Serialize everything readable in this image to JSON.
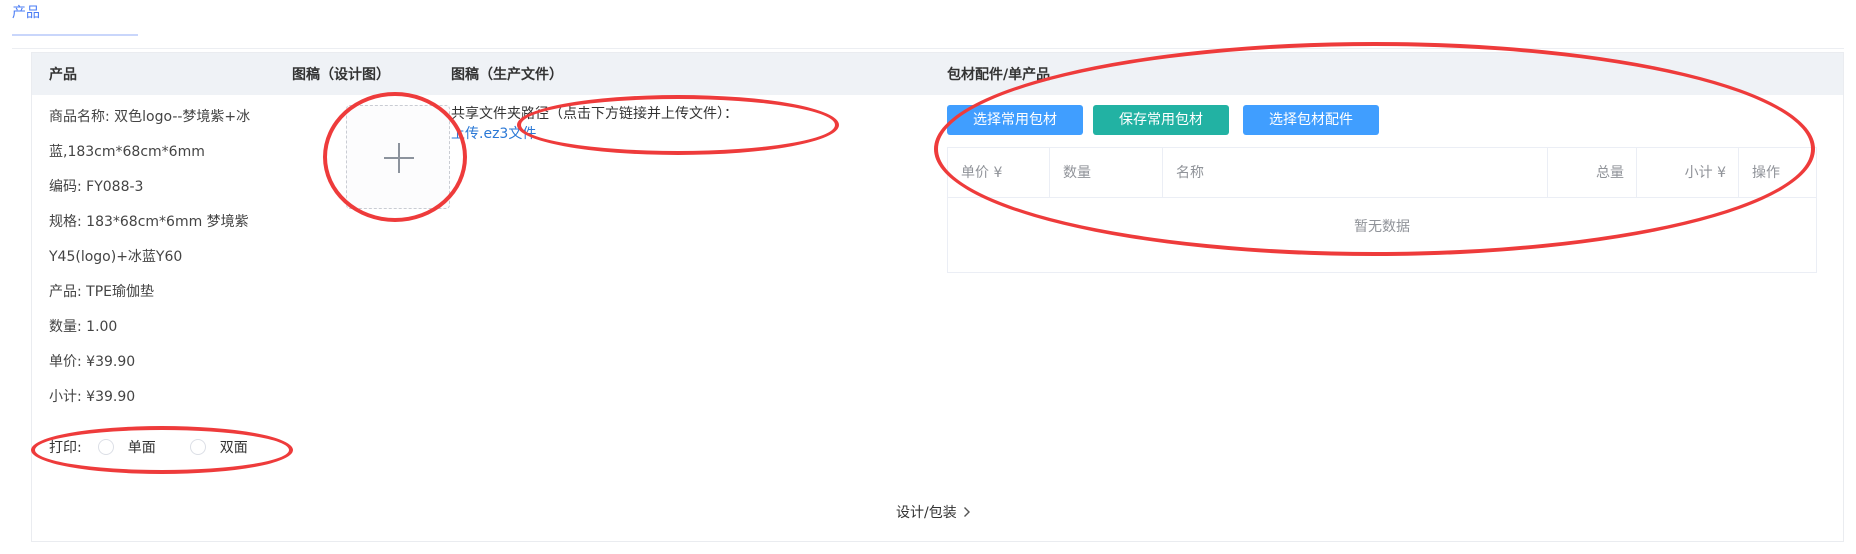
{
  "top_tab": {
    "label": "产品"
  },
  "table_headers": {
    "product": "产品",
    "design_draft": "图稿（设计图）",
    "production_file": "图稿（生产文件）",
    "packaging": "包材配件/单产品"
  },
  "product": {
    "lines": [
      "商品名称: 双色logo--梦境紫+冰",
      "蓝,183cm*68cm*6mm",
      "编码: FY088-3",
      "规格: 183*68cm*6mm 梦境紫",
      "Y45(logo)+冰蓝Y60",
      "产品: TPE瑜伽垫",
      "数量: 1.00",
      "单价: ¥39.90",
      "小计: ¥39.90"
    ]
  },
  "print": {
    "label": "打印:",
    "options": [
      "单面",
      "双面"
    ]
  },
  "upload": {
    "icon": "plus-icon"
  },
  "production_file": {
    "instruction": "共享文件夹路径（点击下方链接并上传文件）：",
    "link": "上传.ez3文件"
  },
  "packaging": {
    "buttons": [
      "选择常用包材",
      "保存常用包材",
      "选择包材配件"
    ],
    "columns": [
      "单价 ¥",
      "数量",
      "名称",
      "总量",
      "小计 ¥",
      "操作"
    ],
    "empty_text": "暂无数据"
  },
  "footer": {
    "link": "设计/包装",
    "icon": "chevron-right-icon"
  },
  "colors": {
    "accent": "#4a7cf5",
    "button_blue": "#409eff",
    "button_teal": "#22b2a3",
    "link": "#2a78d6",
    "annotation_red": "#ee3b3b"
  }
}
